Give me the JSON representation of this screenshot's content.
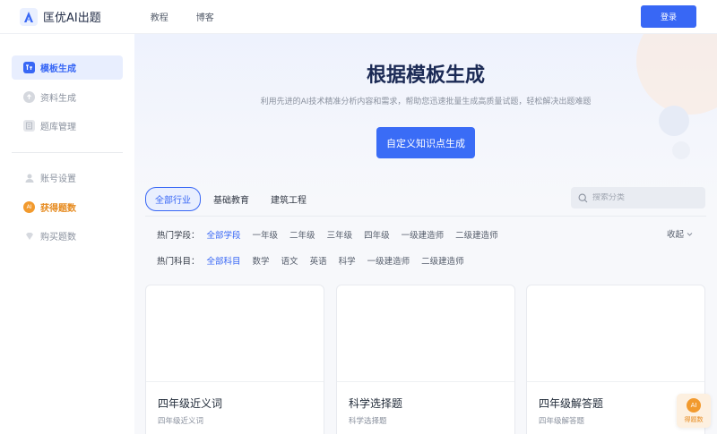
{
  "header": {
    "logo_text": "匡优AI出题",
    "nav": [
      "教程",
      "博客"
    ],
    "login_label": "登录"
  },
  "sidebar": {
    "items": [
      {
        "label": "模板生成",
        "icon": "template-icon",
        "state": "active"
      },
      {
        "label": "资料生成",
        "icon": "upload-icon"
      },
      {
        "label": "题库管理",
        "icon": "question-bank-icon"
      },
      {
        "label": "账号设置",
        "icon": "user-icon"
      },
      {
        "label": "获得题数",
        "icon": "ai-coin-icon",
        "state": "highlight"
      },
      {
        "label": "购买题数",
        "icon": "diamond-icon"
      }
    ]
  },
  "hero": {
    "title": "根据模板生成",
    "subtitle": "利用先进的AI技术精准分析内容和需求，帮助您迅速批量生成高质量试题，轻松解决出题难题",
    "button_label": "自定义知识点生成"
  },
  "tabs": [
    "全部行业",
    "基础教育",
    "建筑工程"
  ],
  "search": {
    "placeholder": "搜索分类",
    "value": ""
  },
  "filters": {
    "stage_title": "热门学段：",
    "stages": [
      "全部学段",
      "一年级",
      "二年级",
      "三年级",
      "四年级",
      "一级建造师",
      "二级建造师"
    ],
    "subject_title": "热门科目：",
    "subjects": [
      "全部科目",
      "数学",
      "语文",
      "英语",
      "科学",
      "一级建造师",
      "二级建造师"
    ],
    "collapse_label": "收起"
  },
  "cards": [
    {
      "title": "四年级近义词",
      "desc": "四年级近义词"
    },
    {
      "title": "科学选择题",
      "desc": "科学选择题"
    },
    {
      "title": "四年级解答题",
      "desc": "四年级解答题"
    }
  ],
  "float_badge": {
    "icon_text": "AI",
    "label": "得题数"
  },
  "colors": {
    "primary": "#3867f5",
    "gold": "#f29a2e",
    "title": "#1b2a55"
  }
}
